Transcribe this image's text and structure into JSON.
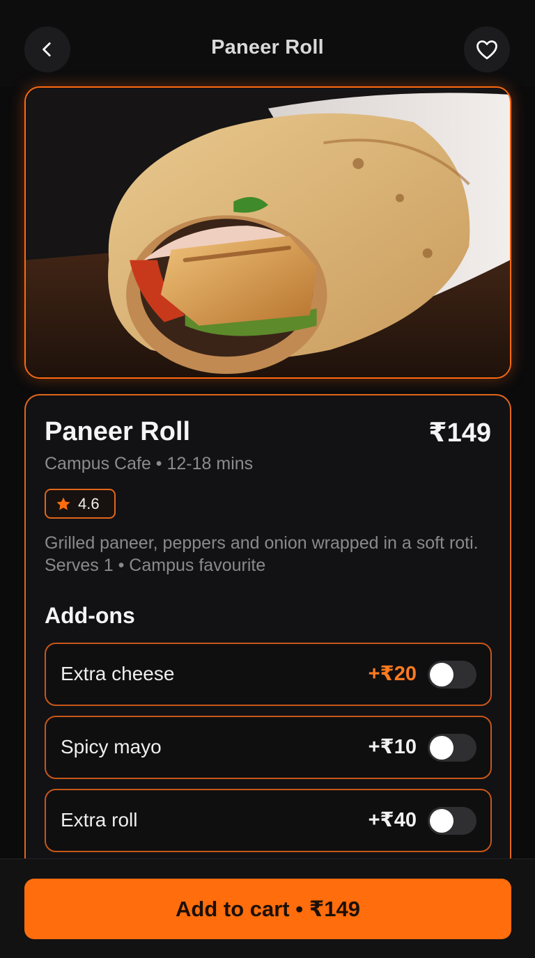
{
  "header": {
    "title": "Paneer Roll",
    "back_icon": "chevron-left-icon",
    "favorite_icon": "heart-outline-icon"
  },
  "hero": {
    "image_subject": "paneer-roll-photo"
  },
  "item": {
    "name": "Paneer Roll",
    "price": "₹149",
    "meta": "Campus Cafe • 12-18 mins",
    "rating": "4.6",
    "rating_icon": "star-icon",
    "description": "Grilled paneer, peppers and onion wrapped in a soft roti. Serves 1 • Campus favourite"
  },
  "addons": {
    "heading": "Add-ons",
    "items": [
      {
        "label": "Extra cheese",
        "price": "+₹20",
        "enabled": false,
        "highlight": true
      },
      {
        "label": "Spicy mayo",
        "price": "+₹10",
        "enabled": false,
        "highlight": false
      },
      {
        "label": "Extra roll",
        "price": "+₹40",
        "enabled": false,
        "highlight": false
      }
    ]
  },
  "cta": {
    "label": "Add to cart • ₹149"
  },
  "colors": {
    "accent": "#ff6d0d",
    "background": "#0b0b0c",
    "card": "#121214"
  }
}
